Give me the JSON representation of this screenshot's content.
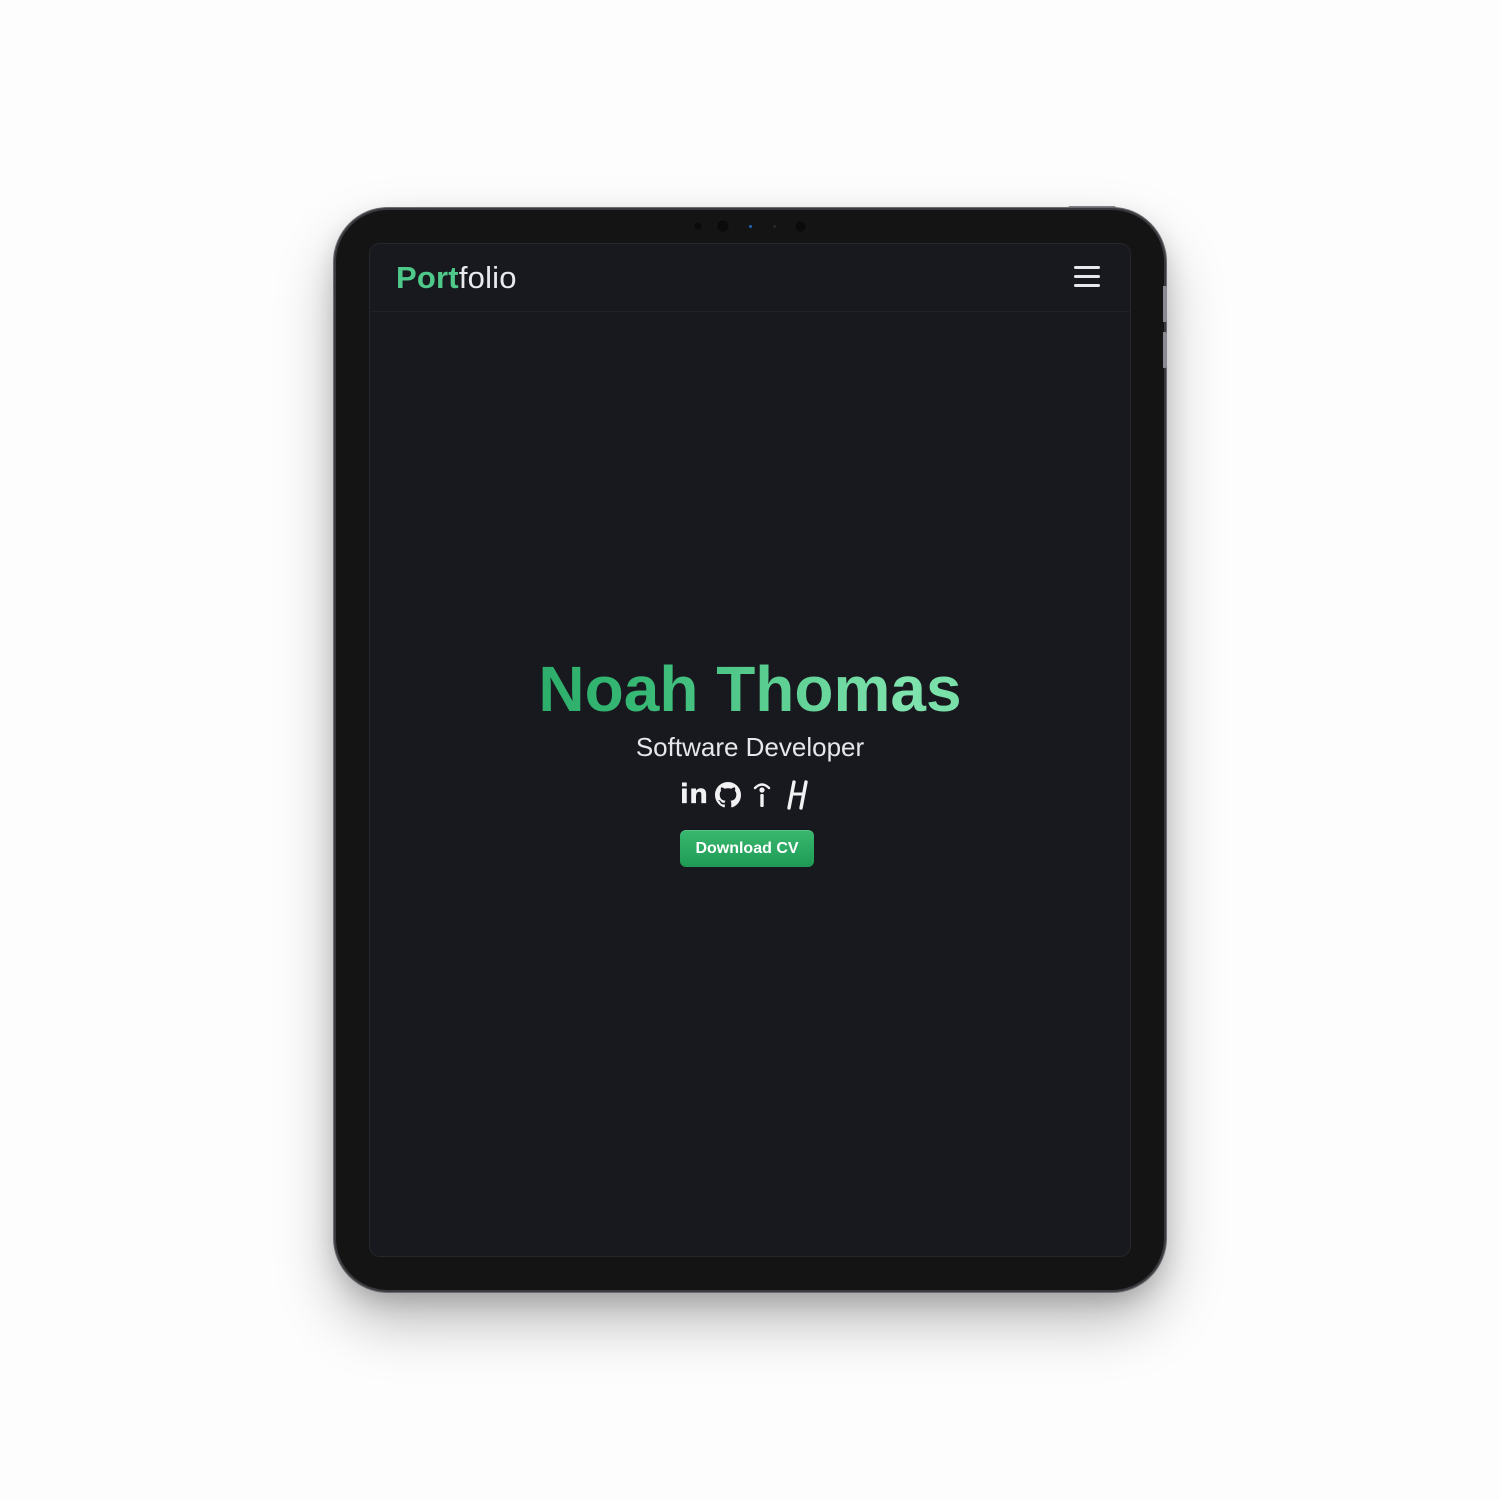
{
  "navbar": {
    "brand_accent": "Port",
    "brand_rest": "folio",
    "menu_icon": "hamburger-menu-icon"
  },
  "hero": {
    "name": "Noah Thomas",
    "role": "Software Developer",
    "socials": [
      {
        "icon": "linkedin-icon",
        "label": "in"
      },
      {
        "icon": "github-icon"
      },
      {
        "icon": "info-icon"
      },
      {
        "icon": "hashnode-icon"
      }
    ],
    "cta_label": "Download CV"
  },
  "colors": {
    "page_background": "#fdfdfd",
    "screen_background": "#18191e",
    "accent": "#4ec98a",
    "button": "#2aa863",
    "text": "#e6e7ea"
  }
}
